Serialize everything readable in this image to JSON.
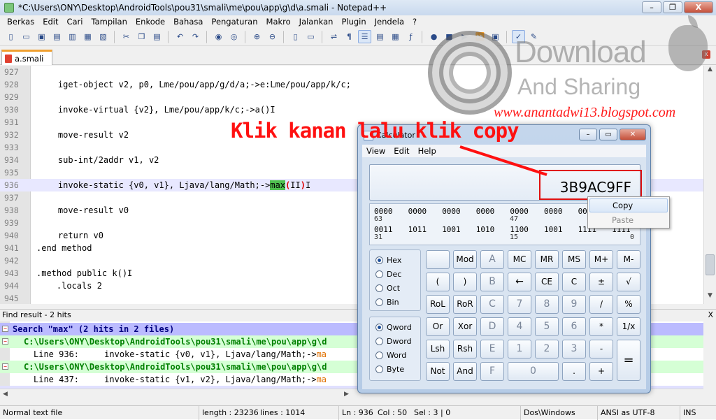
{
  "notepad": {
    "title": "*C:\\Users\\ONY\\Desktop\\AndroidTools\\pou31\\smali\\me\\pou\\app\\g\\d\\a.smali - Notepad++",
    "window_buttons": {
      "minimize": "–",
      "maximize": "❐",
      "close": "X"
    },
    "menu": [
      "Berkas",
      "Edit",
      "Cari",
      "Tampilan",
      "Enkode",
      "Bahasa",
      "Pengaturan",
      "Makro",
      "Jalankan",
      "Plugin",
      "Jendela",
      "?"
    ],
    "tab": {
      "label": "a.smali",
      "close": "x"
    },
    "editor_lines": [
      {
        "num": "927",
        "code": ""
      },
      {
        "num": "928",
        "code": "    iget-object v2, p0, Lme/pou/app/g/d/a;->e:Lme/pou/app/k/c;"
      },
      {
        "num": "929",
        "code": ""
      },
      {
        "num": "930",
        "code": "    invoke-virtual {v2}, Lme/pou/app/k/c;->a()I"
      },
      {
        "num": "931",
        "code": ""
      },
      {
        "num": "932",
        "code": "    move-result v2"
      },
      {
        "num": "933",
        "code": ""
      },
      {
        "num": "934",
        "code": "    sub-int/2addr v1, v2"
      },
      {
        "num": "935",
        "code": ""
      },
      {
        "num": "936",
        "code_before": "    invoke-static {v0, v1}, Ljava/lang/Math;->",
        "code_match": "max",
        "code_open": "(",
        "code_mid": "II",
        "code_close": ")",
        "code_after": "I"
      },
      {
        "num": "937",
        "code": ""
      },
      {
        "num": "938",
        "code": "    move-result v0"
      },
      {
        "num": "939",
        "code": ""
      },
      {
        "num": "940",
        "code": "    return v0"
      },
      {
        "num": "941",
        "code": ".end method"
      },
      {
        "num": "942",
        "code": ""
      },
      {
        "num": "943",
        "code": ".method public k()I"
      },
      {
        "num": "944",
        "code": "    .locals 2"
      },
      {
        "num": "945",
        "code": ""
      }
    ],
    "find": {
      "header": "Find result - 2 hits",
      "close": "X",
      "search_line": "Search \"max\" (2 hits in 2 files)",
      "file_line": "C:\\Users\\ONY\\Desktop\\AndroidTools\\pou31\\smali\\me\\pou\\app\\g\\d",
      "hit1_prefix": "Line 936:     invoke-static {v0, v1}, Ljava/lang/Math;->",
      "hit1_match": "ma",
      "hit2_prefix": "Line 437:     invoke-static {v1, v2}, Ljava/lang/Math;->",
      "hit2_match": "ma"
    },
    "status": {
      "type": "Normal text file",
      "length": "length : 23236",
      "lines": "lines : 1014",
      "ln": "Ln : 936",
      "col": "Col : 50",
      "sel": "Sel : 3 | 0",
      "eol": "Dos\\Windows",
      "enc": "ANSI as UTF-8",
      "ins": "INS"
    }
  },
  "watermark": {
    "download": "Download",
    "sharing": "And Sharing",
    "url": "www.anantadwi13.blogspot.com"
  },
  "annotation": "Klik kanan lalu klik copy",
  "calculator": {
    "title": "Calculator",
    "menu": [
      "View",
      "Edit",
      "Help"
    ],
    "display": "3B9AC9FF",
    "bits_row1": [
      "0000",
      "0000",
      "0000",
      "0000",
      "0000",
      "0000",
      "0000",
      "0000"
    ],
    "bits_row1_labels": {
      "left": "63",
      "mid": "47",
      "right": "32"
    },
    "bits_row2": [
      "0011",
      "1011",
      "1001",
      "1010",
      "1100",
      "1001",
      "1111",
      "1111"
    ],
    "bits_row2_labels": {
      "left": "31",
      "mid": "15",
      "right": "0"
    },
    "base_options": [
      {
        "label": "Hex",
        "selected": true
      },
      {
        "label": "Dec",
        "selected": false
      },
      {
        "label": "Oct",
        "selected": false
      },
      {
        "label": "Bin",
        "selected": false
      }
    ],
    "word_options": [
      {
        "label": "Qword",
        "selected": true
      },
      {
        "label": "Dword",
        "selected": false
      },
      {
        "label": "Word",
        "selected": false
      },
      {
        "label": "Byte",
        "selected": false
      }
    ],
    "keys": {
      "mod": "Mod",
      "a": "A",
      "mc": "MC",
      "mr": "MR",
      "ms": "MS",
      "mplus": "M+",
      "mminus": "M-",
      "lparen": "(",
      "rparen": ")",
      "b": "B",
      "back": "←",
      "ce": "CE",
      "c": "C",
      "plusminus": "±",
      "sqrt": "√",
      "rol": "RoL",
      "ror": "RoR",
      "c_hex": "C",
      "n7": "7",
      "n8": "8",
      "n9": "9",
      "div": "/",
      "pct": "%",
      "or": "Or",
      "xor": "Xor",
      "d": "D",
      "n4": "4",
      "n5": "5",
      "n6": "6",
      "mul": "*",
      "recip": "1/x",
      "lsh": "Lsh",
      "rsh": "Rsh",
      "e": "E",
      "n1": "1",
      "n2": "2",
      "n3": "3",
      "minus": "-",
      "eq": "=",
      "not": "Not",
      "and": "And",
      "f": "F",
      "n0": "0",
      "dot": ".",
      "plus": "+"
    },
    "context_menu": [
      "Copy",
      "Paste"
    ]
  },
  "colors": {
    "annotation": "#ff1010",
    "match_highlight": "#4fc04f",
    "search_bg": "#bbbbff",
    "file_bg": "#d5ffd5"
  }
}
